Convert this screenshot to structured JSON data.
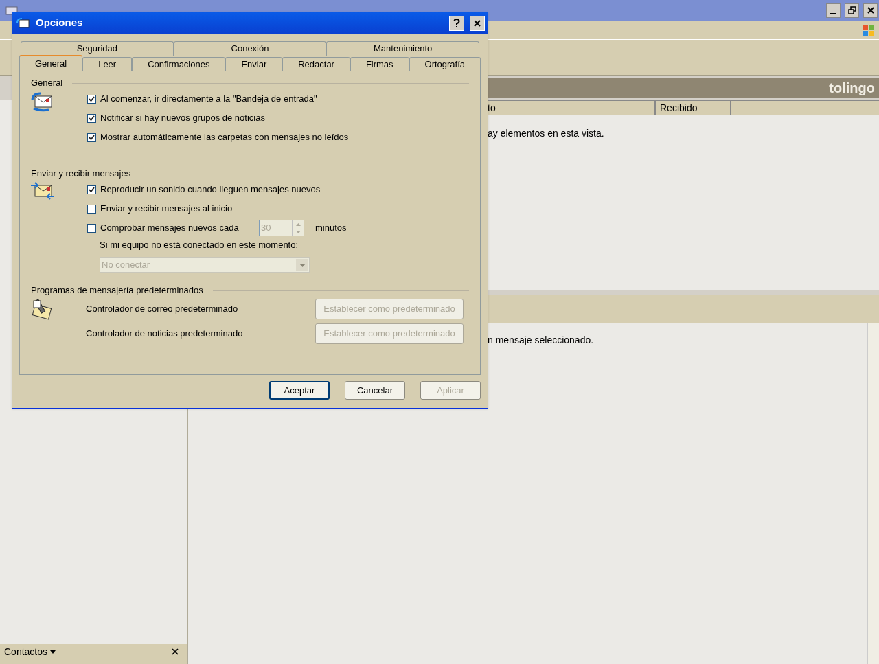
{
  "window": {
    "folder_header": "tolingo"
  },
  "message_list": {
    "columns": [
      "to",
      "Recibido"
    ],
    "empty_text": "ay elementos en esta vista."
  },
  "preview": {
    "text": "n mensaje seleccionado."
  },
  "contacts": {
    "label": "Contactos"
  },
  "dialog": {
    "title": "Opciones",
    "tabs_back": [
      {
        "label": "Seguridad",
        "selected": false
      },
      {
        "label": "Conexión",
        "selected": false
      },
      {
        "label": "Mantenimiento",
        "selected": false
      }
    ],
    "tabs_front": [
      {
        "label": "General",
        "selected": true
      },
      {
        "label": "Leer",
        "selected": false
      },
      {
        "label": "Confirmaciones",
        "selected": false
      },
      {
        "label": "Enviar",
        "selected": false
      },
      {
        "label": "Redactar",
        "selected": false
      },
      {
        "label": "Firmas",
        "selected": false
      },
      {
        "label": "Ortografía",
        "selected": false
      }
    ],
    "sections": [
      {
        "title": "General",
        "rows": [
          {
            "kind": "checkbox",
            "label": "Al comenzar, ir directamente a la \"Bandeja de entrada\"",
            "checked": true
          },
          {
            "kind": "checkbox",
            "label": "Notificar si hay nuevos grupos de noticias",
            "checked": true
          },
          {
            "kind": "checkbox",
            "label": "Mostrar automáticamente las carpetas con mensajes no leídos",
            "checked": true
          }
        ]
      },
      {
        "title": "Enviar y recibir mensajes",
        "rows": [
          {
            "kind": "checkbox",
            "label": "Reproducir un sonido cuando lleguen mensajes nuevos",
            "checked": true
          },
          {
            "kind": "checkbox",
            "label": "Enviar y recibir mensajes al inicio",
            "checked": false
          },
          {
            "kind": "spin",
            "label": "Comprobar mensajes nuevos cada",
            "checked": false,
            "value": "30",
            "unit": "minutos",
            "disabled": true
          },
          {
            "kind": "note",
            "label": "Si mi equipo no está conectado en este momento:"
          },
          {
            "kind": "dropdown",
            "value": "No conectar",
            "disabled": true
          }
        ]
      },
      {
        "title": "Programas de mensajería predeterminados",
        "rows": [
          {
            "kind": "action",
            "label": "Controlador de correo predeterminado",
            "button": "Establecer como predeterminado",
            "disabled": true
          },
          {
            "kind": "action",
            "label": "Controlador de noticias predeterminado",
            "button": "Establecer como predeterminado",
            "disabled": true
          }
        ]
      }
    ],
    "buttons": [
      {
        "label": "Aceptar",
        "disabled": false,
        "default": true
      },
      {
        "label": "Cancelar",
        "disabled": false,
        "default": false
      },
      {
        "label": "Aplicar",
        "disabled": true,
        "default": false
      }
    ]
  }
}
